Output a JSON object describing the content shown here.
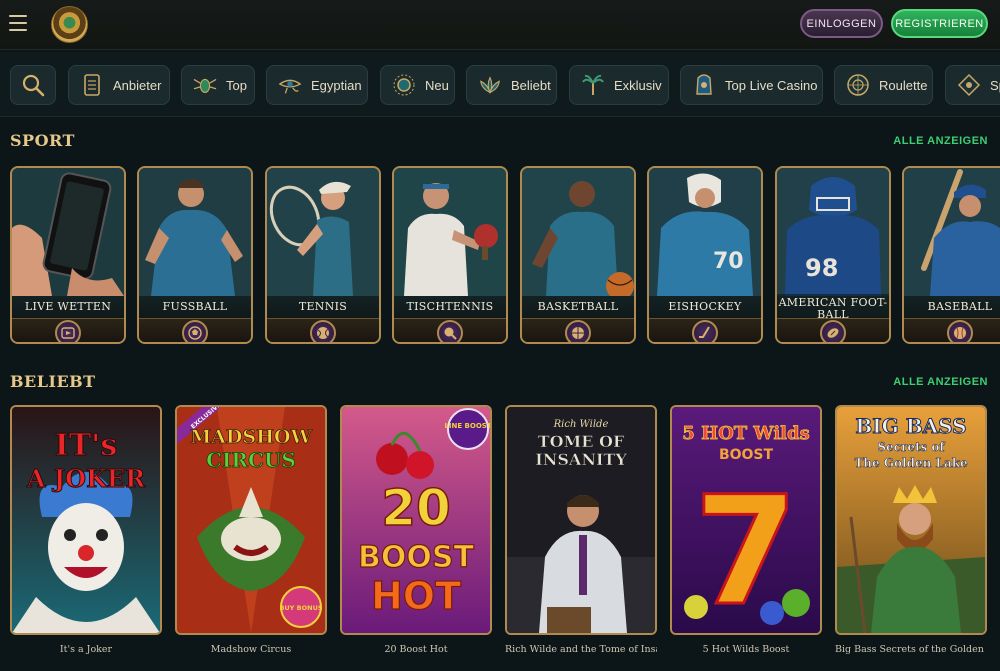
{
  "header": {
    "login_label": "EINLOGGEN",
    "register_label": "REGISTRIEREN"
  },
  "categories": [
    {
      "label": "Anbieter",
      "icon": "scroll-icon"
    },
    {
      "label": "Top",
      "icon": "scarab-icon"
    },
    {
      "label": "Egyptian",
      "icon": "eye-of-horus-icon"
    },
    {
      "label": "Neu",
      "icon": "sun-icon"
    },
    {
      "label": "Beliebt",
      "icon": "lotus-icon"
    },
    {
      "label": "Exklusiv",
      "icon": "palm-icon"
    },
    {
      "label": "Top Live Casino",
      "icon": "pharaoh-icon"
    },
    {
      "label": "Roulette",
      "icon": "roulette-wheel-icon"
    },
    {
      "label": "Sp",
      "icon": "slot-icon"
    }
  ],
  "sport": {
    "title": "SPORT",
    "see_all": "ALLE ANZEIGEN",
    "items": [
      {
        "label": "LIVE WETTEN",
        "icon": "live-play-icon"
      },
      {
        "label": "FUSSBALL",
        "icon": "football-icon"
      },
      {
        "label": "TENNIS",
        "icon": "tennis-ball-icon"
      },
      {
        "label": "TISCHTENNIS",
        "icon": "table-tennis-icon"
      },
      {
        "label": "BASKETBALL",
        "icon": "basketball-icon"
      },
      {
        "label": "EISHOCKEY",
        "icon": "hockey-stick-icon"
      },
      {
        "label": "AMERICAN FOOT-BALL",
        "icon": "american-football-icon"
      },
      {
        "label": "BASEBALL",
        "icon": "baseball-icon"
      }
    ]
  },
  "popular": {
    "title": "BELIEBT",
    "see_all": "ALLE ANZEIGEN",
    "games": [
      {
        "name": "It's a Joker",
        "art_line1": "IT's",
        "art_line2": "A JOKER"
      },
      {
        "name": "Madshow Circus",
        "art_line1": "MADSHOW",
        "art_line2": "CIRCUS",
        "badge": "EXCLUSIVE",
        "bonus": "BUY BONUS"
      },
      {
        "name": "20 Boost Hot",
        "art_line1": "20",
        "art_line2": "BOOST",
        "art_line3": "HOT",
        "badge": "LINE BOOST"
      },
      {
        "name": "Rich Wilde and the Tome of Insa...",
        "art_line1": "Rich Wilde",
        "art_line2": "TOME OF",
        "art_line3": "INSANITY"
      },
      {
        "name": "5 Hot Wilds Boost",
        "art_line1": "5 HOT Wilds",
        "art_line2": "BOOST",
        "art_line3": "7"
      },
      {
        "name": "Big Bass Secrets of the Golden Lake",
        "art_line1": "BIG BASS",
        "art_line2": "Secrets of",
        "art_line3": "The Golden Lake"
      }
    ]
  }
}
